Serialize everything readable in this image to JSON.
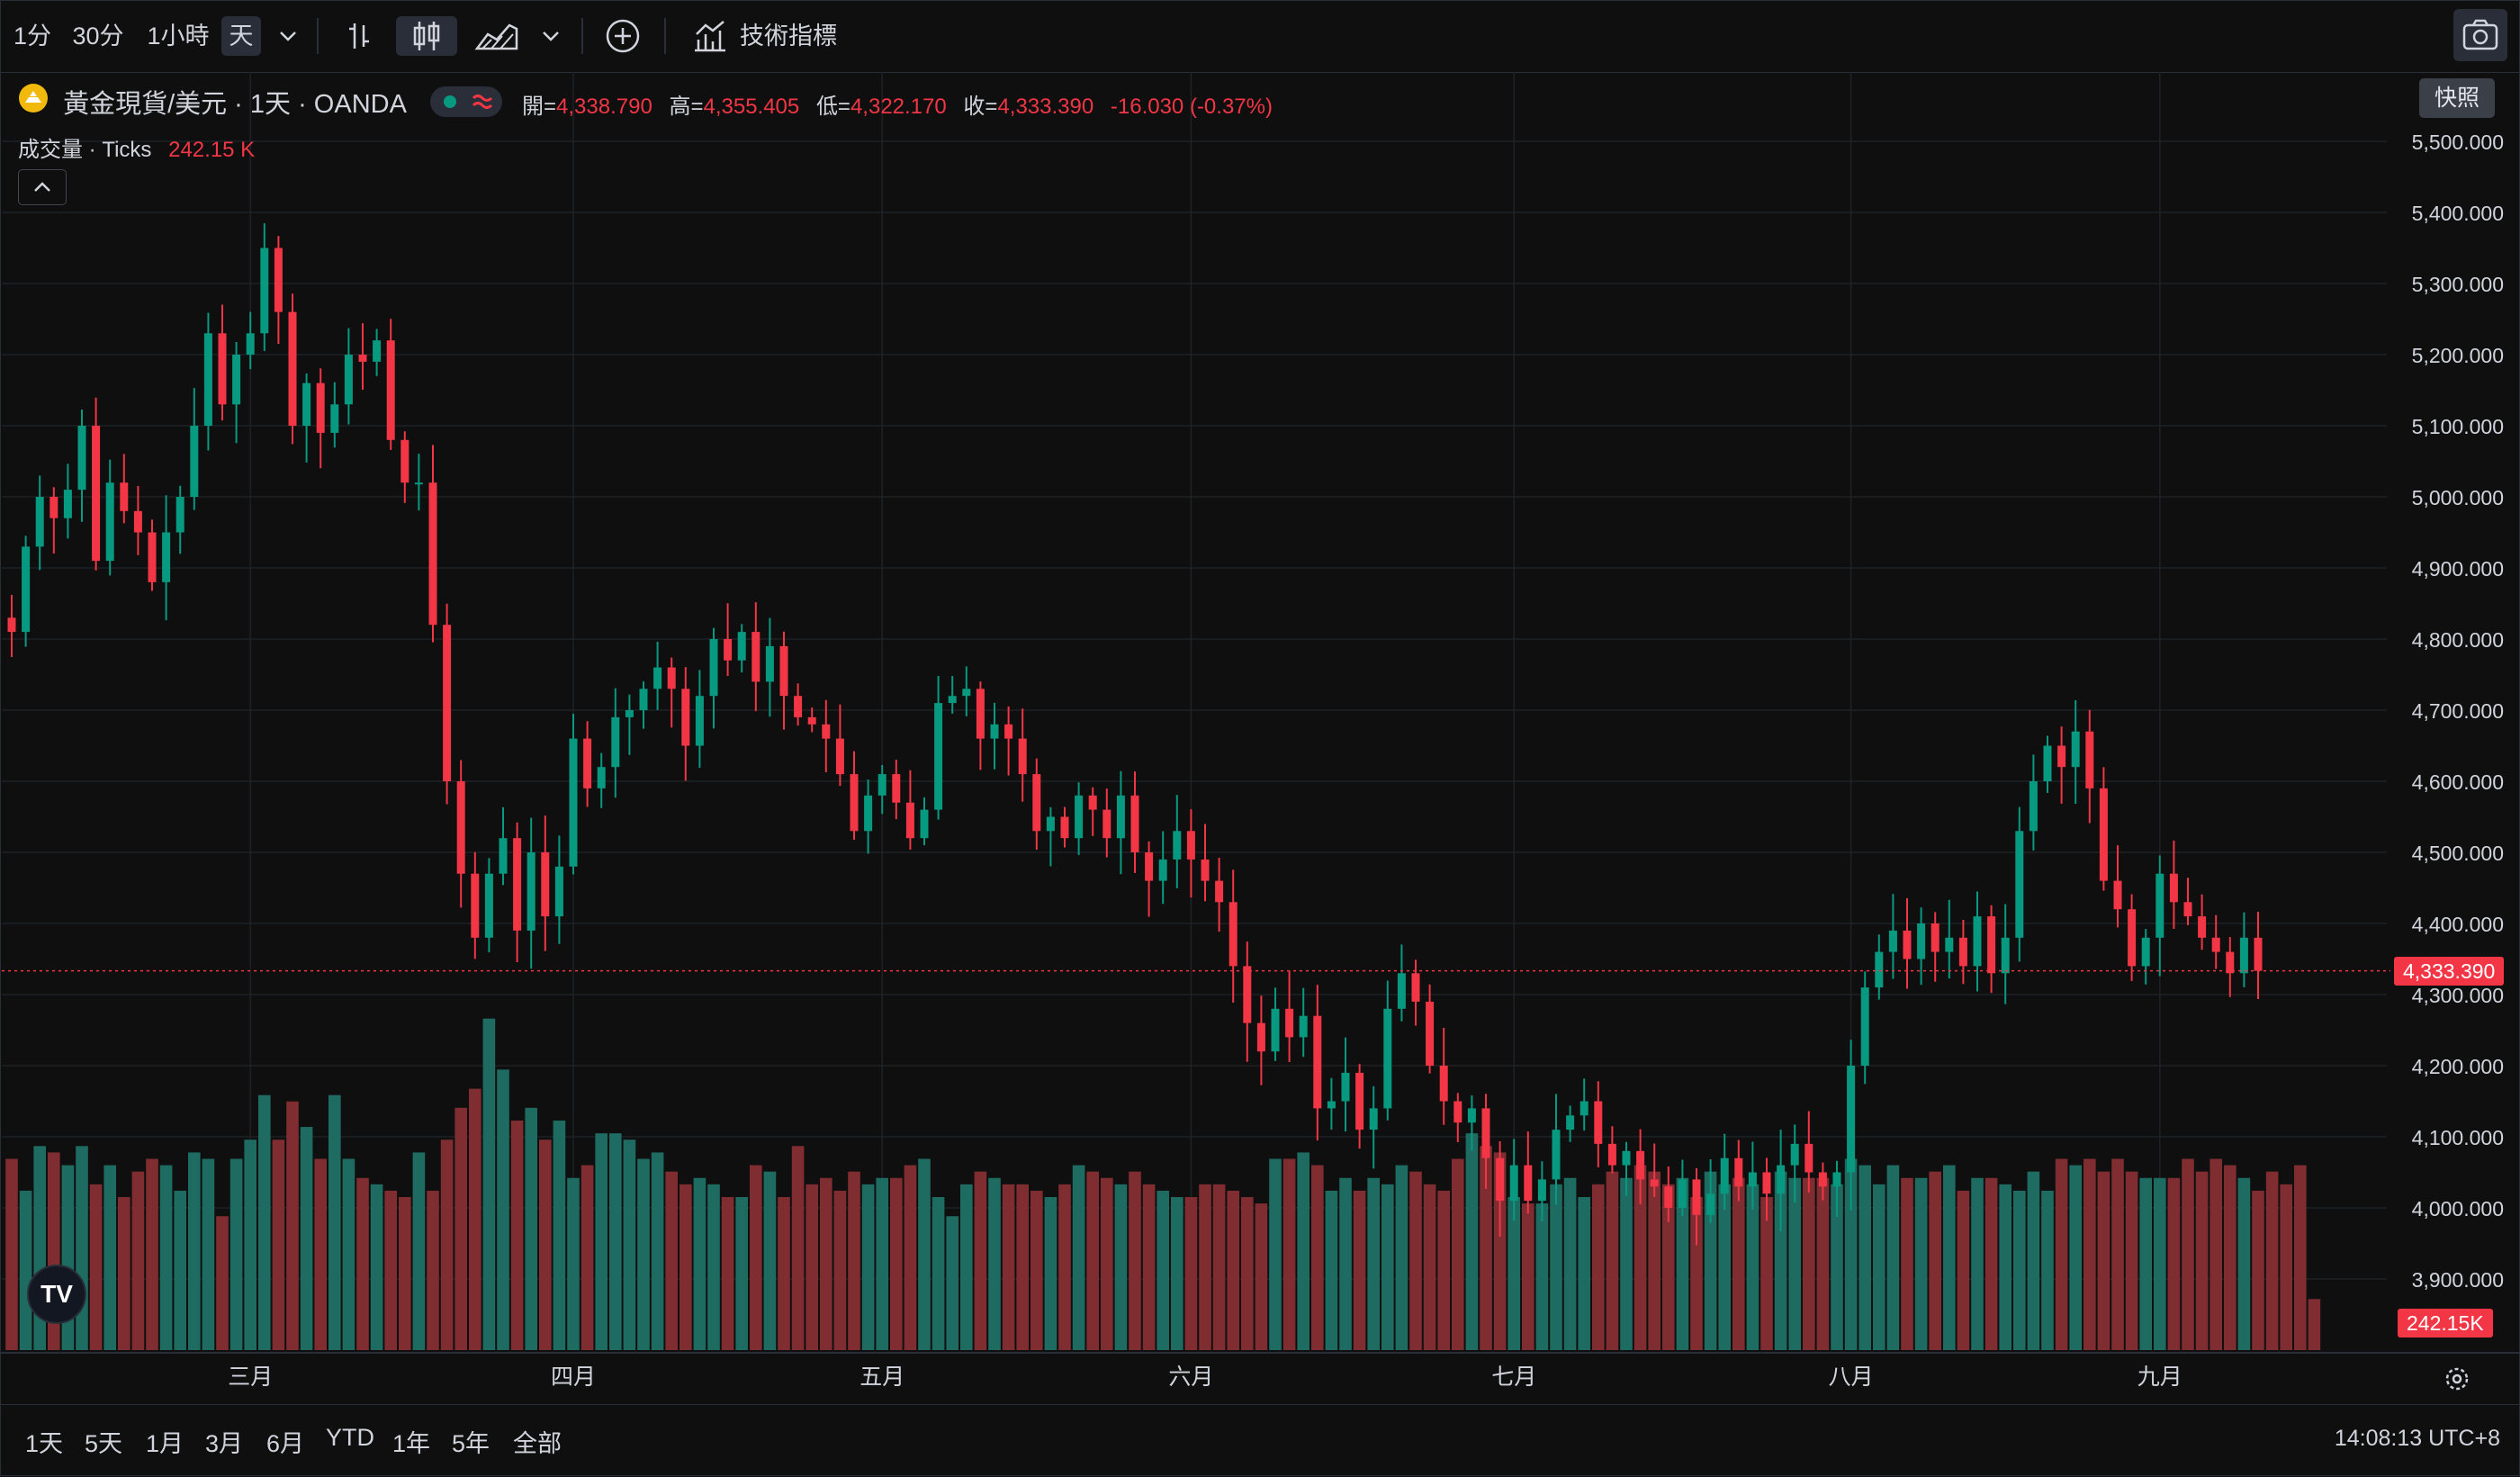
{
  "toolbar": {
    "intervals": [
      "1分",
      "30分",
      "1小時",
      "天"
    ],
    "indicators_label": "技術指標",
    "snapshot_tooltip": "快照"
  },
  "legend": {
    "symbol": "黃金現貨/美元 · 1天 · OANDA",
    "open_label": "開=",
    "open": "4,338.790",
    "high_label": "高=",
    "high": "4,355.405",
    "low_label": "低=",
    "low": "4,322.170",
    "close_label": "收=",
    "close": "4,333.390",
    "change": "-16.030 (-0.37%)",
    "volume_label": "成交量 · Ticks",
    "volume": "242.15 K"
  },
  "price_tag": "4,333.390",
  "volume_tag": "242.15K",
  "bottom": {
    "ranges": [
      "1天",
      "5天",
      "1月",
      "3月",
      "6月",
      "YTD",
      "1年",
      "5年",
      "全部"
    ],
    "clock": "14:08:13 UTC+8"
  },
  "colors": {
    "up": "#089981",
    "down": "#f23645",
    "up_vol": "#1e6b62",
    "down_vol": "#7f2d31",
    "bg": "#0f0f0f",
    "grid": "#1f2227"
  },
  "chart_data": {
    "type": "candlestick",
    "title": "黃金現貨/美元 · 1天 · OANDA",
    "ylim": [
      3800,
      5550
    ],
    "y_ticks": [
      "5,500.000",
      "5,400.000",
      "5,300.000",
      "5,200.000",
      "5,100.000",
      "5,000.000",
      "4,900.000",
      "4,800.000",
      "4,700.000",
      "4,600.000",
      "4,500.000",
      "4,400.000",
      "4,300.000",
      "4,200.000",
      "4,100.000",
      "4,000.000",
      "3,900.000"
    ],
    "x_ticks": [
      {
        "label": "三月",
        "index": 17
      },
      {
        "label": "四月",
        "index": 40
      },
      {
        "label": "五月",
        "index": 62
      },
      {
        "label": "六月",
        "index": 84
      },
      {
        "label": "七月",
        "index": 107
      },
      {
        "label": "八月",
        "index": 131
      },
      {
        "label": "九月",
        "index": 153
      }
    ],
    "last_price": 4333.39,
    "candles_close": [
      4810,
      4930,
      5000,
      4970,
      5010,
      5100,
      4910,
      5020,
      4980,
      4950,
      4880,
      4950,
      5000,
      5100,
      5230,
      5130,
      5200,
      5230,
      5350,
      5260,
      5100,
      5160,
      5090,
      5130,
      5200,
      5190,
      5220,
      5080,
      5020,
      5020,
      4820,
      4600,
      4470,
      4380,
      4470,
      4520,
      4390,
      4500,
      4410,
      4480,
      4660,
      4590,
      4620,
      4690,
      4700,
      4730,
      4760,
      4730,
      4650,
      4720,
      4800,
      4770,
      4810,
      4740,
      4790,
      4720,
      4690,
      4680,
      4660,
      4610,
      4530,
      4580,
      4610,
      4570,
      4520,
      4560,
      4710,
      4720,
      4730,
      4660,
      4680,
      4660,
      4610,
      4530,
      4550,
      4520,
      4580,
      4560,
      4520,
      4580,
      4500,
      4460,
      4490,
      4530,
      4490,
      4460,
      4430,
      4340,
      4260,
      4220,
      4280,
      4240,
      4270,
      4140,
      4150,
      4190,
      4110,
      4140,
      4280,
      4330,
      4290,
      4200,
      4150,
      4120,
      4140,
      4070,
      4010,
      4060,
      4010,
      4040,
      4110,
      4130,
      4150,
      4090,
      4060,
      4080,
      4040,
      4030,
      4000,
      4040,
      3990,
      4020,
      4070,
      4030,
      4050,
      4020,
      4060,
      4090,
      4050,
      4030,
      4050,
      4200,
      4310,
      4360,
      4390,
      4350,
      4400,
      4360,
      4380,
      4340,
      4410,
      4330,
      4380,
      4530,
      4600,
      4650,
      4620,
      4670,
      4590,
      4460,
      4420,
      4340,
      4380,
      4470,
      4430,
      4410,
      4380,
      4360,
      4330,
      4380,
      4333.39
    ],
    "volume_scale_max": 480,
    "volumes": [
      300,
      250,
      320,
      310,
      290,
      320,
      260,
      290,
      240,
      280,
      300,
      290,
      250,
      310,
      300,
      210,
      300,
      330,
      400,
      330,
      390,
      350,
      300,
      400,
      300,
      270,
      260,
      250,
      240,
      310,
      250,
      330,
      380,
      410,
      520,
      440,
      360,
      380,
      330,
      360,
      270,
      290,
      340,
      340,
      330,
      300,
      310,
      280,
      260,
      270,
      260,
      240,
      240,
      290,
      280,
      240,
      320,
      260,
      270,
      250,
      280,
      260,
      270,
      270,
      290,
      300,
      240,
      210,
      260,
      280,
      270,
      260,
      260,
      250,
      240,
      260,
      290,
      280,
      270,
      260,
      280,
      260,
      250,
      240,
      240,
      260,
      260,
      250,
      240,
      230,
      300,
      300,
      310,
      290,
      250,
      270,
      250,
      270,
      260,
      290,
      280,
      260,
      250,
      300,
      340,
      320,
      310,
      240,
      230,
      230,
      260,
      270,
      240,
      260,
      280,
      270,
      290,
      280,
      260,
      270,
      240,
      280,
      260,
      270,
      260,
      240,
      280,
      270,
      270,
      270,
      260,
      300,
      290,
      260,
      290,
      270,
      270,
      280,
      290,
      250,
      270,
      270,
      260,
      250,
      280,
      250,
      300,
      290,
      300,
      280,
      300,
      280,
      270,
      270,
      270,
      300,
      280,
      300,
      290,
      270,
      250,
      280,
      260,
      290,
      80
    ]
  }
}
